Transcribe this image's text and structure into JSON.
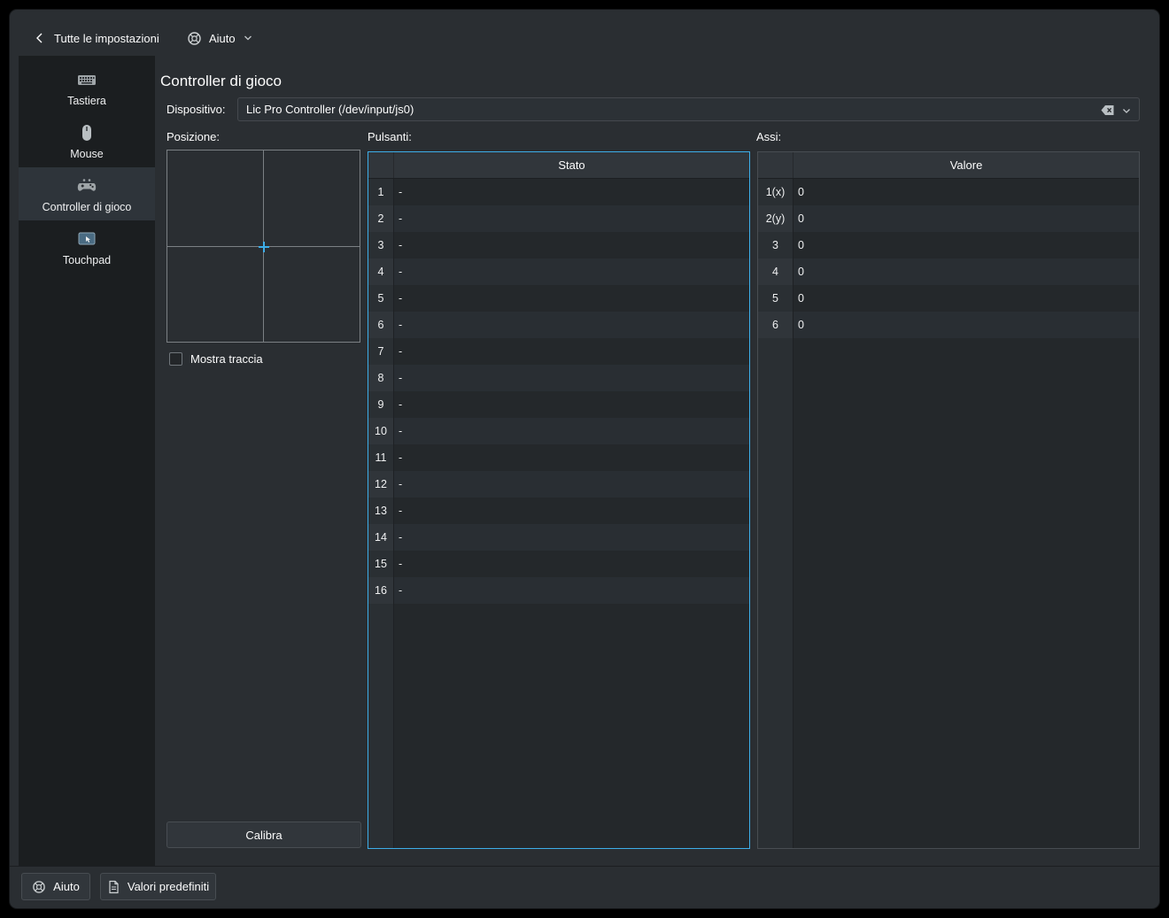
{
  "toolbar": {
    "back_label": "Tutte le impostazioni",
    "help_label": "Aiuto"
  },
  "sidebar": {
    "items": [
      {
        "label": "Tastiera"
      },
      {
        "label": "Mouse"
      },
      {
        "label": "Controller di gioco",
        "selected": true
      },
      {
        "label": "Touchpad"
      }
    ]
  },
  "page": {
    "title": "Controller di gioco",
    "device": {
      "label": "Dispositivo:",
      "value": "Lic Pro Controller (/dev/input/js0)"
    },
    "position": {
      "label": "Posizione:",
      "trace_label": "Mostra traccia",
      "trace_checked": false,
      "calibrate_label": "Calibra"
    },
    "buttons_table": {
      "label": "Pulsanti:",
      "header": "Stato",
      "rows": [
        {
          "id": "1",
          "state": "-"
        },
        {
          "id": "2",
          "state": "-"
        },
        {
          "id": "3",
          "state": "-"
        },
        {
          "id": "4",
          "state": "-"
        },
        {
          "id": "5",
          "state": "-"
        },
        {
          "id": "6",
          "state": "-"
        },
        {
          "id": "7",
          "state": "-"
        },
        {
          "id": "8",
          "state": "-"
        },
        {
          "id": "9",
          "state": "-"
        },
        {
          "id": "10",
          "state": "-"
        },
        {
          "id": "11",
          "state": "-"
        },
        {
          "id": "12",
          "state": "-"
        },
        {
          "id": "13",
          "state": "-"
        },
        {
          "id": "14",
          "state": "-"
        },
        {
          "id": "15",
          "state": "-"
        },
        {
          "id": "16",
          "state": "-"
        }
      ]
    },
    "axes_table": {
      "label": "Assi:",
      "header": "Valore",
      "rows": [
        {
          "id": "1(x)",
          "value": "0"
        },
        {
          "id": "2(y)",
          "value": "0"
        },
        {
          "id": "3",
          "value": "0"
        },
        {
          "id": "4",
          "value": "0"
        },
        {
          "id": "5",
          "value": "0"
        },
        {
          "id": "6",
          "value": "0"
        }
      ]
    }
  },
  "footer": {
    "help_label": "Aiuto",
    "defaults_label": "Valori predefiniti"
  },
  "colors": {
    "accent": "#3daee9",
    "window_bg": "#2a2e32",
    "sidebar_bg": "#1b1e20"
  }
}
